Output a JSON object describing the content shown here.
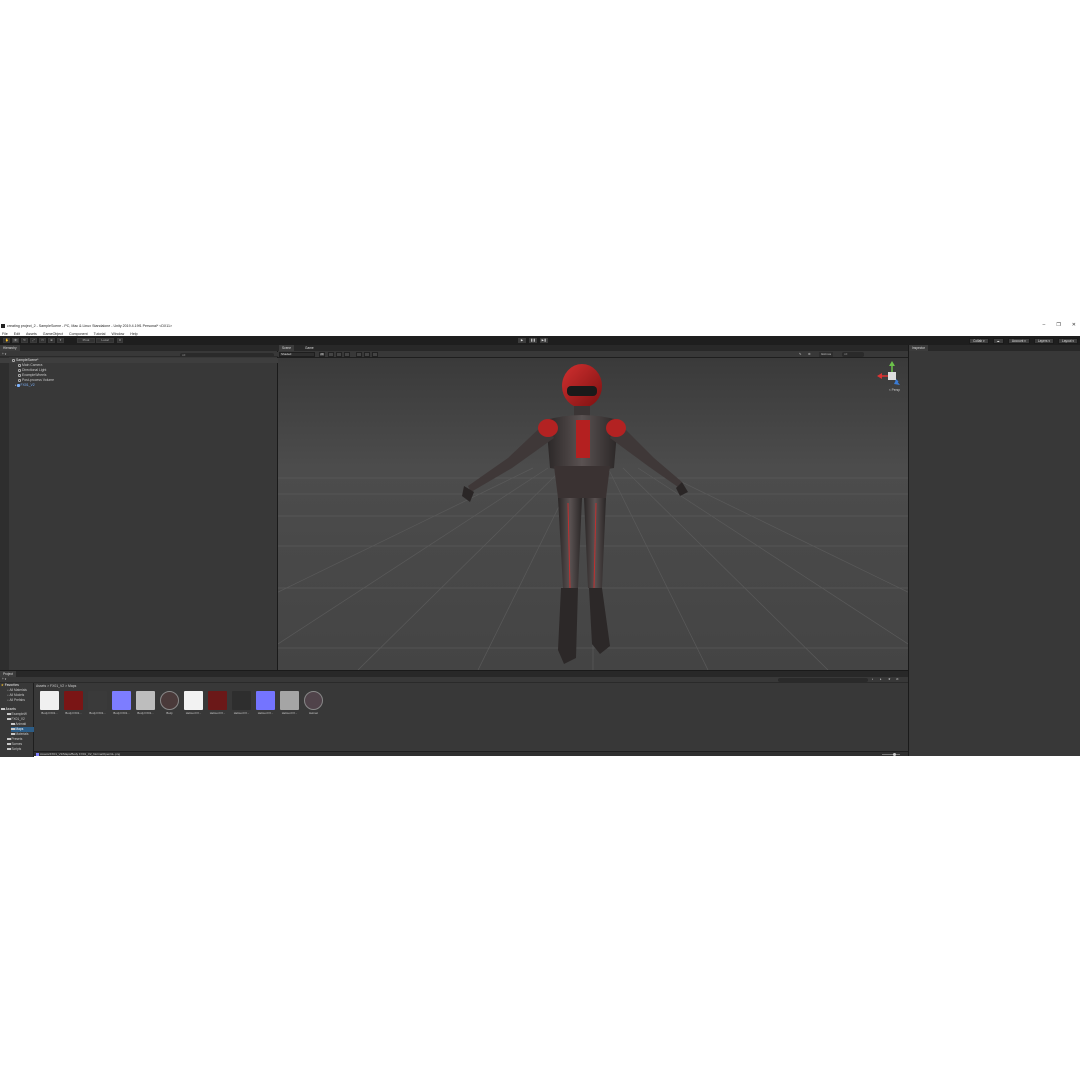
{
  "window": {
    "title": "creating project_2 - SampleScene - PC, Mac & Linux Standalone - Unity 2019.4.19f1 Personal* <DX11>",
    "controls": [
      "–",
      "❐",
      "✕"
    ]
  },
  "menu": [
    "File",
    "Edit",
    "Assets",
    "GameObject",
    "Component",
    "Tutorial",
    "Window",
    "Help"
  ],
  "toolbar": {
    "pivot_label": "Pivot",
    "local_label": "Local",
    "play_icons": [
      "▶",
      "❚❚",
      "▶❚"
    ],
    "collab_label": "Collab ▾",
    "account_label": "Account ▾",
    "layers_label": "Layers ▾",
    "layout_label": "Layout ▾"
  },
  "hierarchy": {
    "tab_label": "Hierarchy",
    "add_label": "+ ▾",
    "search_placeholder": "All",
    "scene_label": "SampleScene*",
    "items": [
      "Main Camera",
      "Directional Light",
      "ExampleWheels",
      "Post-process Volume",
      "FX01_V2"
    ]
  },
  "scene": {
    "tab_scene": "Scene",
    "tab_game": "Game",
    "shading": "Shaded",
    "mode_2d": "2D",
    "gizmos_label": "Gizmos",
    "all_label": "All",
    "persp_label": "< Persp"
  },
  "inspector": {
    "tab_label": "Inspector"
  },
  "project": {
    "tab_label": "Project",
    "favorites_label": "Favorites",
    "favorites": [
      "All Materials",
      "All Models",
      "All Prefabs"
    ],
    "assets_label": "Assets",
    "tree": [
      "ExampleW",
      "FX01_V2",
      "Animati",
      "Maps",
      "Materials",
      "Presets",
      "Scenes",
      "Scripts"
    ],
    "breadcrumb": "Assets > FX01_V2 > Maps",
    "items": [
      {
        "label": "Body FX01...",
        "color": "#f0f0f0"
      },
      {
        "label": "Body FX01...",
        "color": "#7a1515"
      },
      {
        "label": "Body FX01...",
        "color": "#3a3a3a"
      },
      {
        "label": "Body FX01...",
        "color": "#7d7dff"
      },
      {
        "label": "Body FX01...",
        "color": "#bdbdbd"
      },
      {
        "label": "Body",
        "color": "#4a3a3a"
      },
      {
        "label": "Helmet FX...",
        "color": "#f2f2f2"
      },
      {
        "label": "Helmet FX...",
        "color": "#6b1818"
      },
      {
        "label": "Helmet FX...",
        "color": "#2e2e2e"
      },
      {
        "label": "Helmet FX...",
        "color": "#7474ff"
      },
      {
        "label": "Helmet FX...",
        "color": "#a5a5a5"
      },
      {
        "label": "Helmet",
        "color": "#50434a"
      }
    ],
    "status_path": "Assets/FX01_V2/Maps/Body FX01_V2_NormalOpenGL.png"
  }
}
